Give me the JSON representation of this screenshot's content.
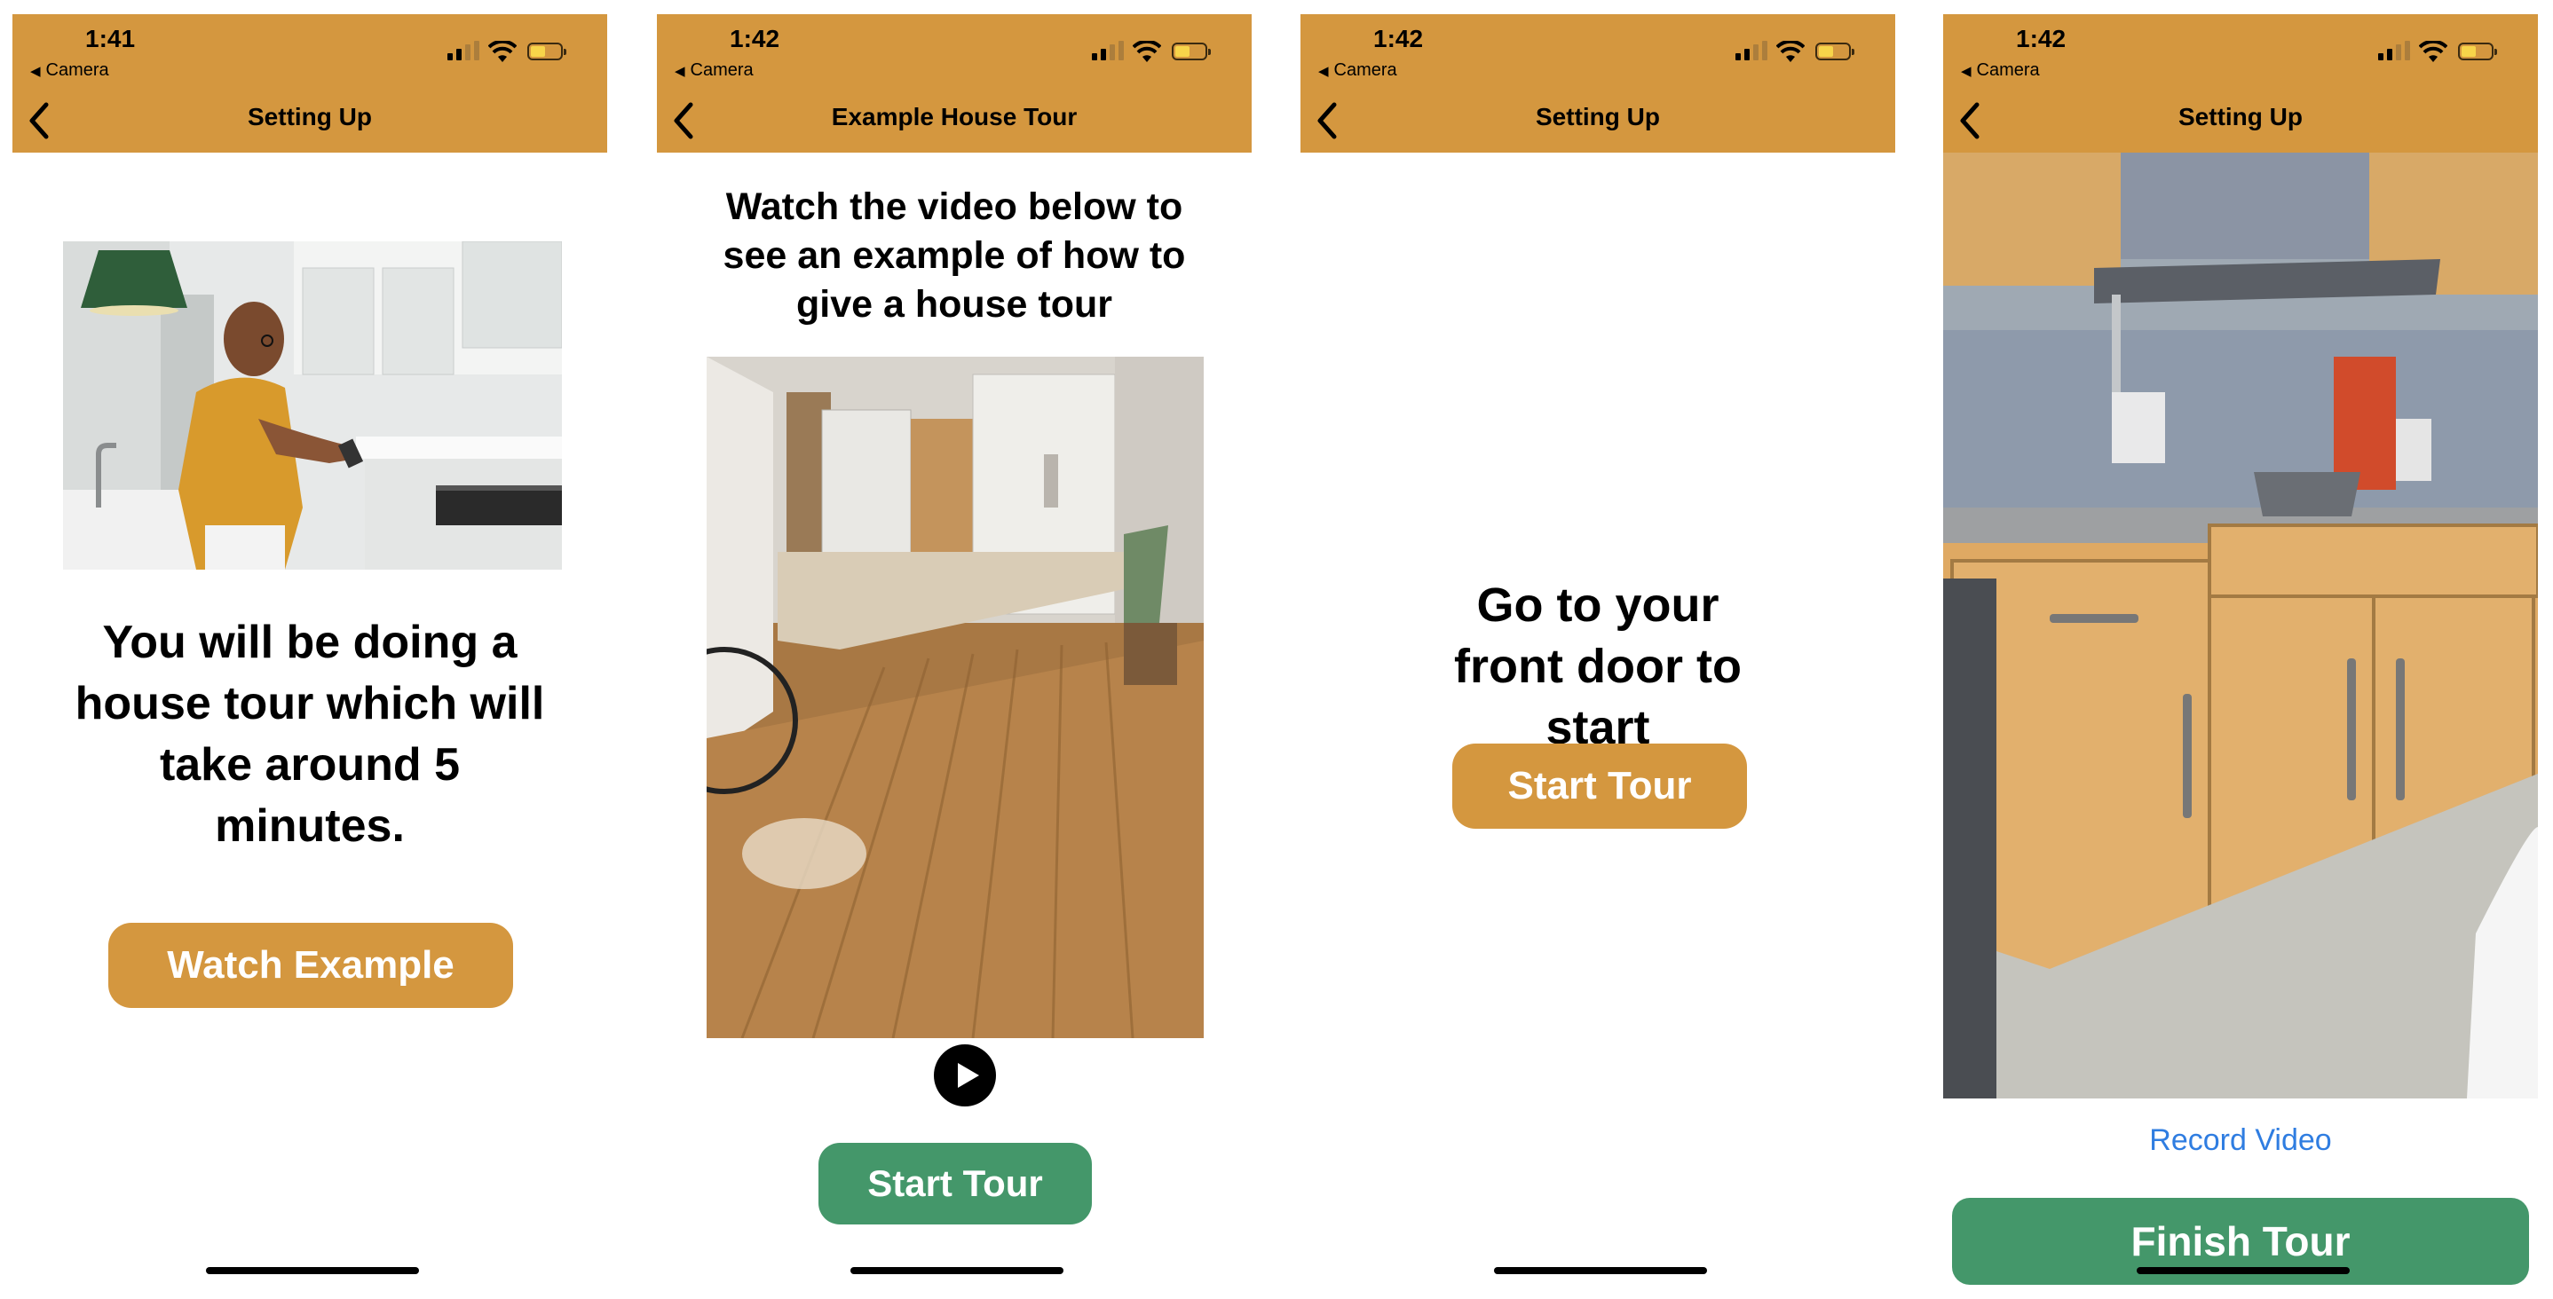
{
  "screens": [
    {
      "time": "1:41",
      "back_app": "Camera",
      "nav_title": "Setting Up",
      "body_text": "You will be doing a house tour which will take around 5 minutes.",
      "button": "Watch Example"
    },
    {
      "time": "1:42",
      "back_app": "Camera",
      "nav_title": "Example House Tour",
      "body_text": "Watch the video below to see an example of how to give a house tour",
      "button": "Start Tour"
    },
    {
      "time": "1:42",
      "back_app": "Camera",
      "nav_title": "Setting Up",
      "body_text": "Go to your front door to start",
      "button": "Start Tour"
    },
    {
      "time": "1:42",
      "back_app": "Camera",
      "nav_title": "Setting Up",
      "record_link": "Record Video",
      "button": "Finish Tour"
    }
  ],
  "colors": {
    "navbar": "#d4973f",
    "primary_button": "#d4973f",
    "secondary_button": "#44976a",
    "link": "#2f7de1"
  }
}
